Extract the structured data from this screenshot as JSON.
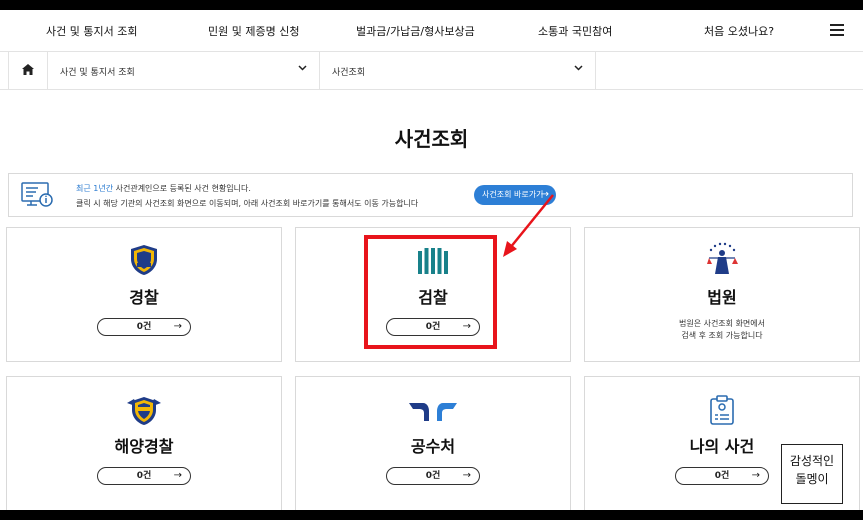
{
  "topnav": {
    "items": [
      "사건 및 통지서 조회",
      "민원 및 제증명 신청",
      "벌과금/가납금/형사보상금",
      "소통과 국민참여",
      "처음 오셨나요?"
    ]
  },
  "breadcrumb": {
    "level1": "사건 및 통지서 조회",
    "level2": "사건조회"
  },
  "page": {
    "title": "사건조회"
  },
  "notice": {
    "highlight": "최근 1년간",
    "line1_rest": " 사건관계인으로 등록된 사건 현황입니다.",
    "line2": "클릭 시 해당 기관의 사건조회 화면으로 이동되며, 아래 사건조회 바로가기를 통해서도 이동 가능합니다",
    "button": "사건조회 바로가기"
  },
  "cards": [
    {
      "name": "경찰",
      "count": "0건",
      "icon": "police-badge-icon"
    },
    {
      "name": "검찰",
      "count": "0건",
      "icon": "prosecution-logo-icon"
    },
    {
      "name": "법원",
      "desc1": "법원은 사건조회 화면에서",
      "desc2": "검색 후 조회 가능합니다",
      "icon": "court-justice-icon"
    },
    {
      "name": "해양경찰",
      "count": "0건",
      "icon": "coast-guard-badge-icon"
    },
    {
      "name": "공수처",
      "count": "0건",
      "icon": "cio-logo-icon"
    },
    {
      "name": "나의 사건",
      "count": "0건",
      "icon": "clipboard-person-icon"
    }
  ],
  "watermark": {
    "line1": "감성적인",
    "line2": "돌멩이"
  },
  "colors": {
    "accent": "#2d7fd6",
    "highlight": "#e8141b",
    "text": "#111111"
  }
}
